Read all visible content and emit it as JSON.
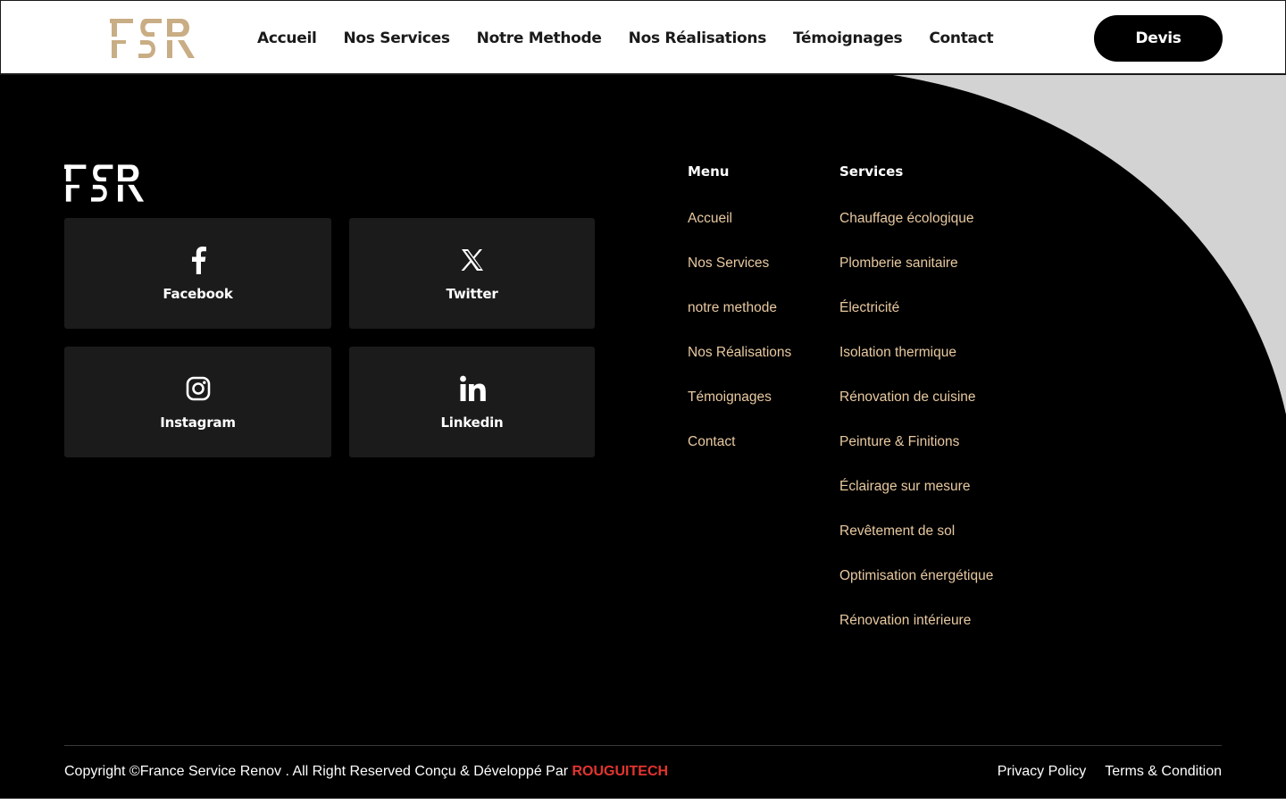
{
  "header": {
    "logo_text": "FSR",
    "nav": [
      {
        "label": "Accueil"
      },
      {
        "label": "Nos Services"
      },
      {
        "label": "Notre Methode"
      },
      {
        "label": "Nos Réalisations"
      },
      {
        "label": "Témoignages"
      },
      {
        "label": "Contact"
      }
    ],
    "cta_label": "Devis"
  },
  "footer": {
    "logo_text": "FSR",
    "social": [
      {
        "label": "Facebook",
        "icon": "facebook-icon"
      },
      {
        "label": "Twitter",
        "icon": "x-twitter-icon"
      },
      {
        "label": "Instagram",
        "icon": "instagram-icon"
      },
      {
        "label": "Linkedin",
        "icon": "linkedin-icon"
      }
    ],
    "menu": {
      "title": "Menu",
      "items": [
        "Accueil",
        "Nos Services",
        "notre methode",
        "Nos Réalisations",
        "Témoignages",
        "Contact"
      ]
    },
    "services": {
      "title": "Services",
      "items": [
        "Chauffage écologique",
        "Plomberie sanitaire",
        "Électricité",
        "Isolation thermique",
        "Rénovation de cuisine",
        "Peinture & Finitions",
        "Éclairage sur mesure",
        "Revêtement de sol",
        "Optimisation énergétique",
        "Rénovation intérieure"
      ]
    },
    "copyright_text": "Copyright ©France Service Renov . All Right Reserved Conçu & Développé Par ",
    "copyright_brand": "ROUGUITECH",
    "legal": {
      "privacy": "Privacy Policy",
      "terms": "Terms & Condition"
    }
  },
  "colors": {
    "accent_gold": "#c9ad84",
    "link_color": "#e8c9a0",
    "brand_red": "#e3342f",
    "tile_bg": "#1b1b1b",
    "curve_gray": "#d3d3d3"
  }
}
